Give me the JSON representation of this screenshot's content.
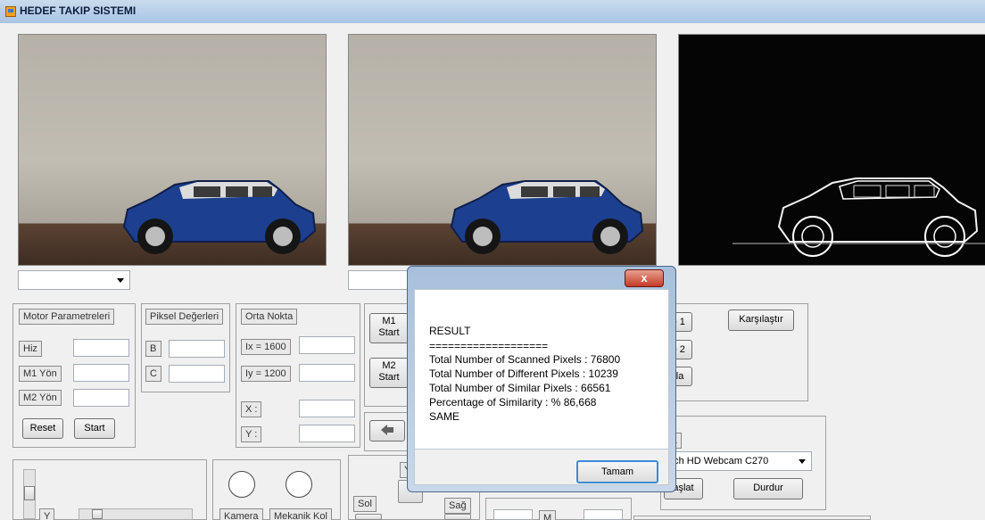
{
  "window": {
    "title": "HEDEF TAKIP SISTEMI"
  },
  "motor_group": {
    "title": "Motor Parametreleri",
    "speed_label": "Hiz",
    "m1_label": "M1 Yön",
    "m2_label": "M2 Yön",
    "reset_label": "Reset",
    "start_label": "Start"
  },
  "pixel_group": {
    "title": "Piksel Değerleri",
    "b_label": "B",
    "c_label": "C"
  },
  "center_group": {
    "title": "Orta Nokta",
    "ix_label": "Ix = 1600",
    "iy_label": "Iy = 1200",
    "x_label": "X :",
    "y_label": "Y :"
  },
  "motor_buttons": {
    "m1_start": [
      "M1",
      "Start"
    ],
    "m2_start": [
      "M2",
      "Start"
    ]
  },
  "compare_group": {
    "button1_label": "le 1",
    "button2_label": "le 2",
    "button3_label": "ala",
    "compare_label": "Karşılaştır"
  },
  "camera_group": {
    "title": "ra",
    "device_value": "ech HD Webcam C270",
    "start_label": "aşlat",
    "stop_label": "Durdur"
  },
  "bottom": {
    "y_label": "Y",
    "camera_label": "Kamera",
    "arm_label": "Mekanik Kol",
    "left_label": "Sol",
    "right_label": "Sağ",
    "y2_label": "Y",
    "m_label": "M"
  },
  "dialog": {
    "title_text": "RESULT",
    "separator": "===================",
    "scanned": "Total Number of Scanned Pixels : 76800",
    "different": "Total Number of Different Pixels : 10239",
    "similar": "Total Number of Similar Pixels : 66561",
    "percentage": "Percentage of Similarity  : % 86,668",
    "verdict": "SAME",
    "ok_label": "Tamam",
    "close_glyph": "x"
  }
}
